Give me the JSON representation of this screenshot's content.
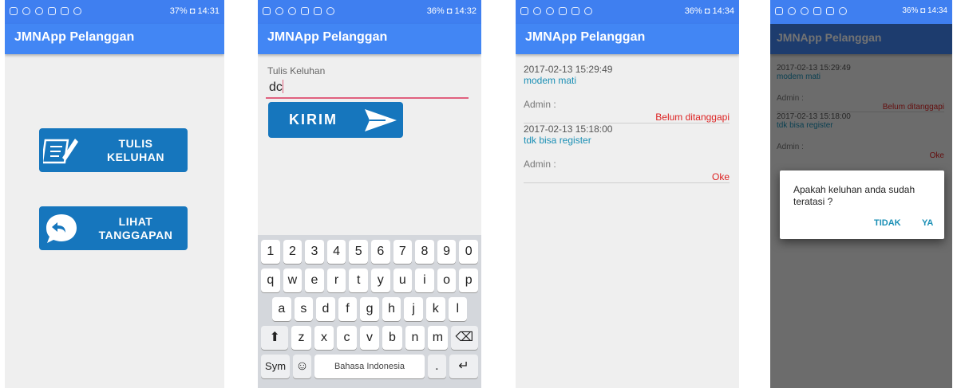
{
  "app_title": "JMNApp Pelanggan",
  "screen1": {
    "status_right": "37% ◘ 14:31",
    "tulis_button": "TULIS\nKELUHAN",
    "lihat_button": "LIHAT\nTANGGAPAN"
  },
  "screen2": {
    "status_right": "36% ◘ 14:32",
    "field_label": "Tulis Keluhan",
    "field_value": "dc",
    "send_button": "KIRIM",
    "keyboard": {
      "row_numbers": [
        "1",
        "2",
        "3",
        "4",
        "5",
        "6",
        "7",
        "8",
        "9",
        "0"
      ],
      "row1": [
        "q",
        "w",
        "e",
        "r",
        "t",
        "y",
        "u",
        "i",
        "o",
        "p"
      ],
      "row2": [
        "a",
        "s",
        "d",
        "f",
        "g",
        "h",
        "j",
        "k",
        "l"
      ],
      "row3": [
        "z",
        "x",
        "c",
        "v",
        "b",
        "n",
        "m"
      ],
      "shift": "⬆",
      "backspace": "⌫",
      "sym": "Sym",
      "emoji": "☺",
      "space": "Bahasa Indonesia",
      "period": ".",
      "enter": "↵"
    }
  },
  "screen3": {
    "status_right": "36% ◘ 14:34",
    "entries": [
      {
        "date": "2017-02-13 15:29:49",
        "message": "modem mati",
        "admin": "Admin :",
        "status": "Belum ditanggapi"
      },
      {
        "date": "2017-02-13 15:18:00",
        "message": "tdk bisa register",
        "admin": "Admin :",
        "status": "Oke"
      }
    ]
  },
  "screen4": {
    "status_right": "36% ◘ 14:34",
    "dialog_text": "Apakah keluhan anda sudah teratasi ?",
    "no_button": "TIDAK",
    "yes_button": "YA"
  }
}
